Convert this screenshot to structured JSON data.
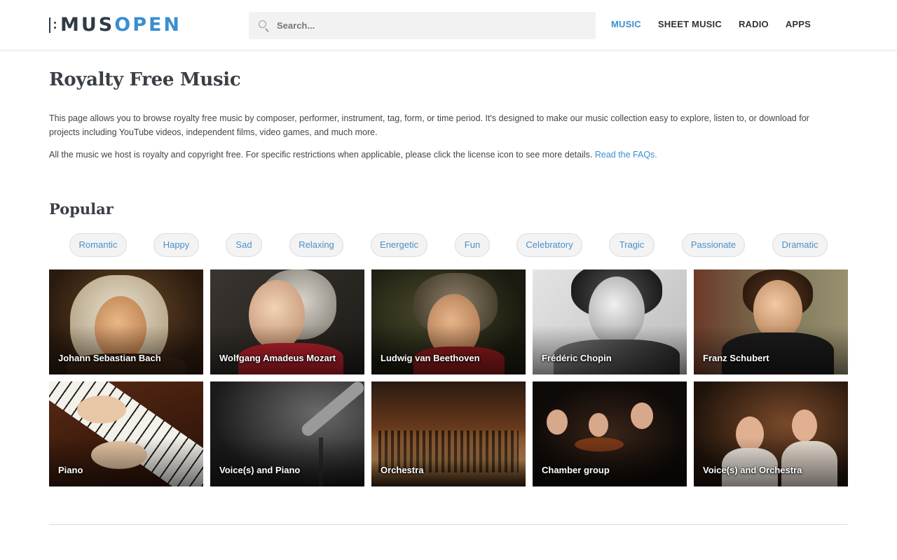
{
  "header": {
    "logo_part1": "MUS",
    "logo_part2": "OPEN",
    "search_placeholder": "Search...",
    "nav": [
      {
        "label": "MUSIC",
        "active": true
      },
      {
        "label": "SHEET MUSIC",
        "active": false
      },
      {
        "label": "RADIO",
        "active": false
      },
      {
        "label": "APPS",
        "active": false
      }
    ]
  },
  "main": {
    "title": "Royalty Free Music",
    "intro": "This page allows you to browse royalty free music by composer, performer, instrument, tag, form, or time period. It's designed to make our music collection easy to explore, listen to, or download for projects including YouTube videos, independent films, video games, and much more.",
    "intro2": "All the music we host is royalty and copyright free. For specific restrictions when applicable, please click the license icon to see more details.",
    "faq_link": "Read the FAQs.",
    "popular_title": "Popular",
    "tags": [
      "Romantic",
      "Happy",
      "Sad",
      "Relaxing",
      "Energetic",
      "Fun",
      "Celebratory",
      "Tragic",
      "Passionate",
      "Dramatic"
    ],
    "cards": [
      {
        "label": "Johann Sebastian Bach"
      },
      {
        "label": "Wolfgang Amadeus Mozart"
      },
      {
        "label": "Ludwig van Beethoven"
      },
      {
        "label": "Frédéric Chopin"
      },
      {
        "label": "Franz Schubert"
      },
      {
        "label": "Piano"
      },
      {
        "label": "Voice(s) and Piano"
      },
      {
        "label": "Orchestra"
      },
      {
        "label": "Chamber group"
      },
      {
        "label": "Voice(s) and Orchestra"
      }
    ]
  },
  "colors": {
    "accent": "#3a8fd0",
    "logo_dark": "#2f3a45",
    "heading": "#3a3f45"
  }
}
